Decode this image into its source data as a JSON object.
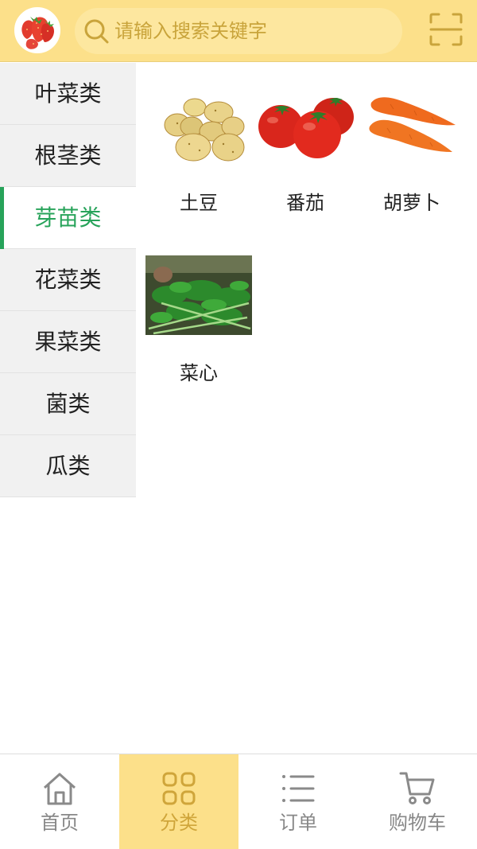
{
  "search": {
    "placeholder": "请输入搜索关键字"
  },
  "sidebar": {
    "items": [
      {
        "label": "叶菜类",
        "active": false
      },
      {
        "label": "根茎类",
        "active": false
      },
      {
        "label": "芽苗类",
        "active": true
      },
      {
        "label": "花菜类",
        "active": false
      },
      {
        "label": "果菜类",
        "active": false
      },
      {
        "label": "菌类",
        "active": false
      },
      {
        "label": "瓜类",
        "active": false
      }
    ]
  },
  "products": [
    {
      "name": "土豆",
      "icon": "potato-image"
    },
    {
      "name": "番茄",
      "icon": "tomato-image"
    },
    {
      "name": "胡萝卜",
      "icon": "carrot-image"
    },
    {
      "name": "菜心",
      "icon": "choy-sum-image"
    }
  ],
  "tabbar": {
    "tabs": [
      {
        "label": "首页",
        "icon": "home-icon",
        "active": false
      },
      {
        "label": "分类",
        "icon": "category-icon",
        "active": true
      },
      {
        "label": "订单",
        "icon": "list-icon",
        "active": false
      },
      {
        "label": "购物车",
        "icon": "cart-icon",
        "active": false
      }
    ]
  },
  "colors": {
    "header": "#fce08a",
    "accent": "#27a35a",
    "tab_active": "#cfa53a"
  }
}
